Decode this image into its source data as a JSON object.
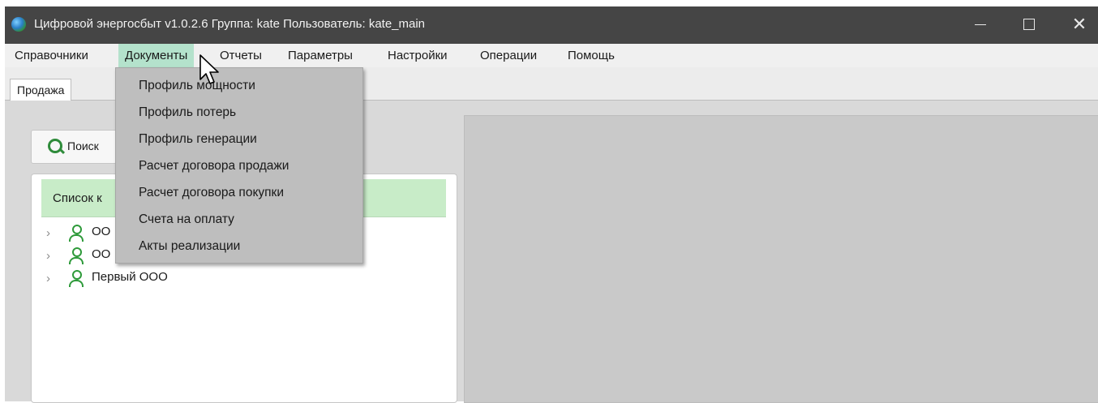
{
  "window": {
    "title": "Цифровой энергосбыт v1.0.2.6 Группа: kate Пользователь: kate_main",
    "close_glyph": "✕"
  },
  "menubar": {
    "items": [
      "Справочники",
      "Документы",
      "Отчеты",
      "Параметры",
      "Настройки",
      "Операции",
      "Помощь"
    ],
    "active": "Документы"
  },
  "dropdown": {
    "items": [
      "Профиль мощности",
      "Профиль потерь",
      "Профиль генерации",
      "Расчет договора продажи",
      "Расчет договора покупки",
      "Счета на оплату",
      "Акты реализации"
    ]
  },
  "tabs": {
    "active": "Продажа"
  },
  "search": {
    "label": "Поиск"
  },
  "client_list": {
    "header": "Список к",
    "items": [
      "ОО",
      "ОО",
      "Первый ООО"
    ]
  },
  "colors": {
    "titlebar": "#454545",
    "menu_active": "#b4e2cc",
    "list_header": "#c8ecc8",
    "icon_green": "#2e9a3a"
  }
}
